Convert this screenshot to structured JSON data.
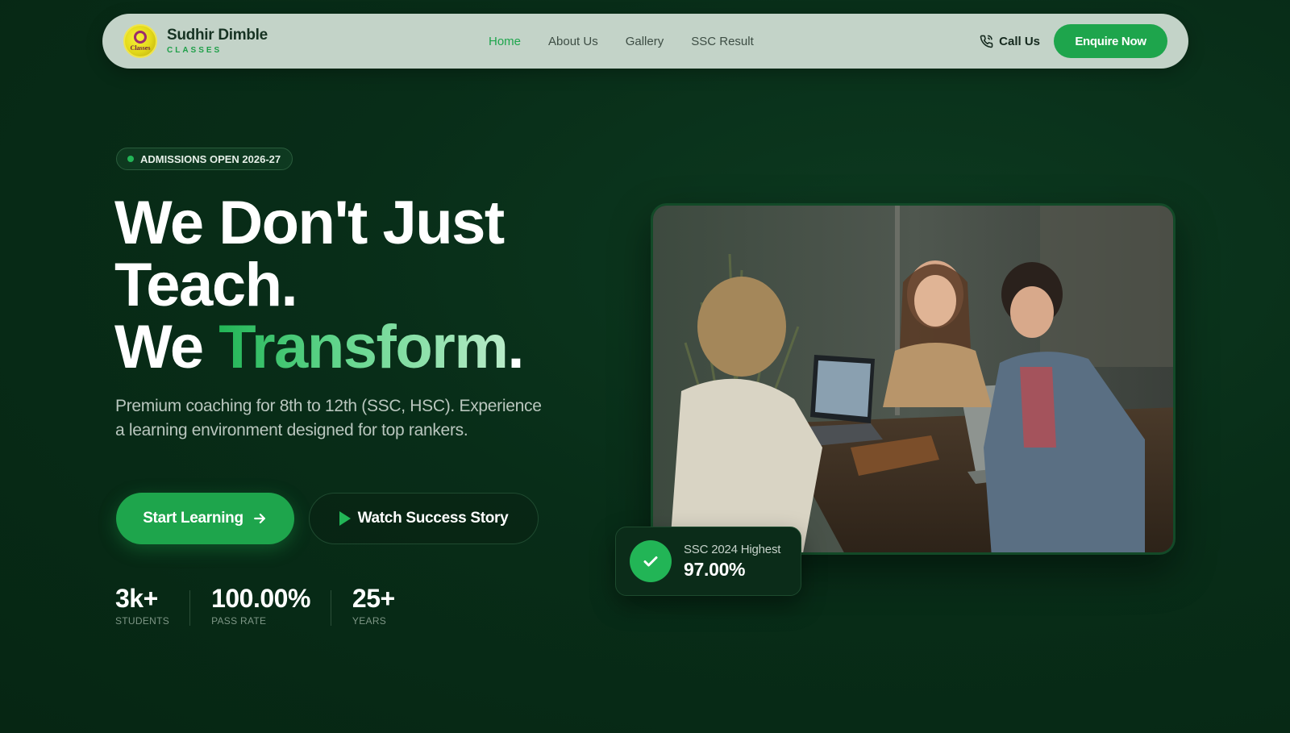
{
  "nav": {
    "brand_name": "Sudhir Dimble",
    "brand_sub": "CLASSES",
    "logo_text": "Classes",
    "links": [
      {
        "label": "Home",
        "active": true
      },
      {
        "label": "About Us",
        "active": false
      },
      {
        "label": "Gallery",
        "active": false
      },
      {
        "label": "SSC Result",
        "active": false
      }
    ],
    "call_label": "Call Us",
    "enquire_label": "Enquire Now"
  },
  "hero": {
    "badge": "ADMISSIONS OPEN 2026-27",
    "headline_line1": "We Don't Just",
    "headline_line2": "Teach.",
    "headline_line3_plain": "We ",
    "headline_line3_highlight": "Transform",
    "headline_line3_end": ".",
    "description": "Premium coaching for 8th to 12th (SSC, HSC). Experience a learning environment designed for top rankers.",
    "primary_cta": "Start Learning",
    "secondary_cta": "Watch Success Story",
    "stats": [
      {
        "value": "3k+",
        "label": "STUDENTS"
      },
      {
        "value": "100.00%",
        "label": "PASS RATE"
      },
      {
        "value": "25+",
        "label": "YEARS"
      }
    ]
  },
  "score_card": {
    "label": "SSC 2024 Highest",
    "value": "97.00%"
  },
  "colors": {
    "accent": "#1ea54c",
    "background": "#082d18",
    "nav_bg": "#c3d3c8"
  },
  "icons": [
    "phone-icon",
    "arrow-right-icon",
    "play-icon",
    "check-icon",
    "logo-icon"
  ]
}
